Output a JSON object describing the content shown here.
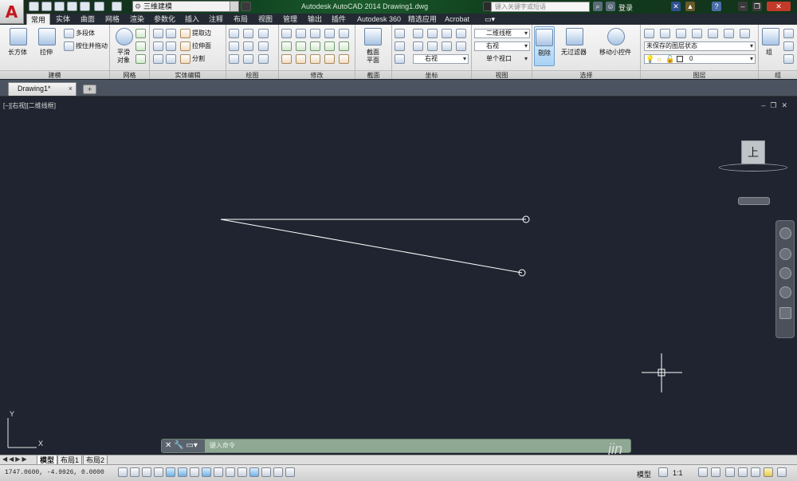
{
  "title_bar": {
    "workspace": "三维建模",
    "title": "Autodesk AutoCAD 2014    Drawing1.dwg",
    "search_placeholder": "键入关键字或短语",
    "login": "登录"
  },
  "tabs": [
    "常用",
    "实体",
    "曲面",
    "网格",
    "渲染",
    "参数化",
    "插入",
    "注释",
    "布局",
    "视图",
    "管理",
    "输出",
    "插件",
    "Autodesk 360",
    "精选应用",
    "Acrobat"
  ],
  "active_tab": "常用",
  "ribbon": {
    "modeling": {
      "label": "建模",
      "box": "长方体",
      "extrude": "拉伸",
      "polysolid": "多段体",
      "presspull": "按住并拖动"
    },
    "mesh": {
      "label": "网格",
      "smooth": "平滑\n对象",
      "smooth1": "平滑",
      "smooth2": "对象"
    },
    "solid_edit": {
      "label": "实体编辑",
      "extract_edges": "提取边",
      "extrude_faces": "拉伸面",
      "separate": "分割"
    },
    "draw": {
      "label": "绘图"
    },
    "modify": {
      "label": "修改"
    },
    "section": {
      "label": "截面",
      "plane1": "截面",
      "plane2": "平面"
    },
    "coordinates": {
      "label": "坐标",
      "view_combo": "右视"
    },
    "view": {
      "label": "视图",
      "visual_style": "二维线框",
      "view_combo": "右视",
      "single_viewport": "单个视口"
    },
    "selection": {
      "label": "选择",
      "cull": "剔除",
      "no_filter": "无过滤器",
      "gizmo": "移动小控件"
    },
    "layers": {
      "label": "图层",
      "layer_state": "未保存的图层状态",
      "current_layer": "0"
    },
    "groups": {
      "label": "组",
      "group": "组"
    }
  },
  "document": {
    "tab": "Drawing1*",
    "close": "×",
    "new_tab": "+"
  },
  "viewport": {
    "label": "[−][右视][二维线框]",
    "viewcube_face": "上",
    "ucs_x": "X",
    "ucs_y": "Y"
  },
  "command_line": {
    "placeholder": "键入命令"
  },
  "layout_tabs": [
    "模型",
    "布局1",
    "布局2"
  ],
  "status": {
    "coordinates": "1747.0600, -4.9926, 0.0000",
    "model": "模型",
    "scale": "1:1"
  },
  "watermark": "jin",
  "colors": {
    "canvas": "#1f2430",
    "ribbon": "#ececec",
    "accent": "#c4161c",
    "line": "#ffffff"
  }
}
